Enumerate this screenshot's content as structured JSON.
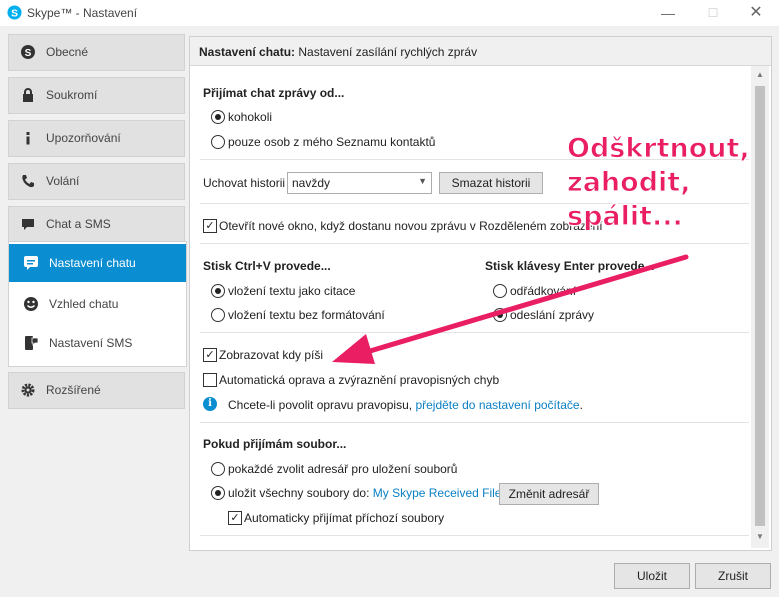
{
  "window": {
    "title": "Skype™ - Nastavení",
    "controls": {
      "minimize": "—",
      "maximize": "☐",
      "close": "✕"
    }
  },
  "sidebar": {
    "items": [
      {
        "label": "Obecné",
        "icon": "skype-icon"
      },
      {
        "label": "Soukromí",
        "icon": "lock-icon"
      },
      {
        "label": "Upozorňování",
        "icon": "info-icon"
      },
      {
        "label": "Volání",
        "icon": "phone-icon"
      },
      {
        "label": "Chat a SMS",
        "icon": "chat-icon"
      },
      {
        "label": "Rozšířené",
        "icon": "gear-icon"
      }
    ],
    "sub_items": [
      {
        "label": "Nastavení chatu",
        "icon": "chat-bubble-icon",
        "active": true
      },
      {
        "label": "Vzhled chatu",
        "icon": "smiley-icon",
        "active": false
      },
      {
        "label": "Nastavení SMS",
        "icon": "sms-icon",
        "active": false
      }
    ]
  },
  "panel": {
    "header_bold": "Nastavení chatu:",
    "header_rest": " Nastavení zasílání rychlých zpráv",
    "receive_title": "Přijímat chat zprávy od...",
    "receive_options": [
      "kohokoli",
      "pouze osob z mého Seznamu kontaktů"
    ],
    "receive_selected": 0,
    "history_label": "Uchovat historii",
    "history_value": "navždy",
    "clear_history_button": "Smazat historii",
    "open_window_text": "Otevřít nové okno, když dostanu novou zprávu v Rozděleném zobrazení",
    "open_window_checked": true,
    "ctrlv_title": "Stisk Ctrl+V provede...",
    "ctrlv_options": [
      "vložení textu jako citace",
      "vložení textu bez formátování"
    ],
    "ctrlv_selected": 0,
    "enter_title": "Stisk klávesy Enter provede...",
    "enter_options": [
      "odřádkování",
      "odeslání zprávy"
    ],
    "enter_selected": 1,
    "show_typing_label": "Zobrazovat kdy píši",
    "show_typing_checked": true,
    "autocorrect_label": "Automatická oprava a zvýraznění pravopisných chyb",
    "autocorrect_checked": false,
    "spell_info_text": "Chcete-li povolit opravu pravopisu, ",
    "spell_info_link": "přejděte do nastavení počítače",
    "spell_info_end": ".",
    "file_title": "Pokud přijímám soubor...",
    "file_option_1": "pokaždé zvolit adresář pro uložení souborů",
    "file_option_2": "uložit všechny soubory do: ",
    "file_folder_link": "My Skype Received Files",
    "file_selected": 1,
    "change_dir_button": "Změnit adresář",
    "auto_accept_label": "Automaticky přijímat příchozí soubory",
    "auto_accept_checked": true
  },
  "footer": {
    "save_button": "Uložit",
    "cancel_button": "Zrušit"
  },
  "annotation": {
    "lines": [
      "Odškrtnout,",
      "zahodit,",
      "spálit..."
    ],
    "color": "#ea1e63"
  },
  "colors": {
    "accent": "#0a8dd1",
    "link": "#0a7fc4"
  }
}
